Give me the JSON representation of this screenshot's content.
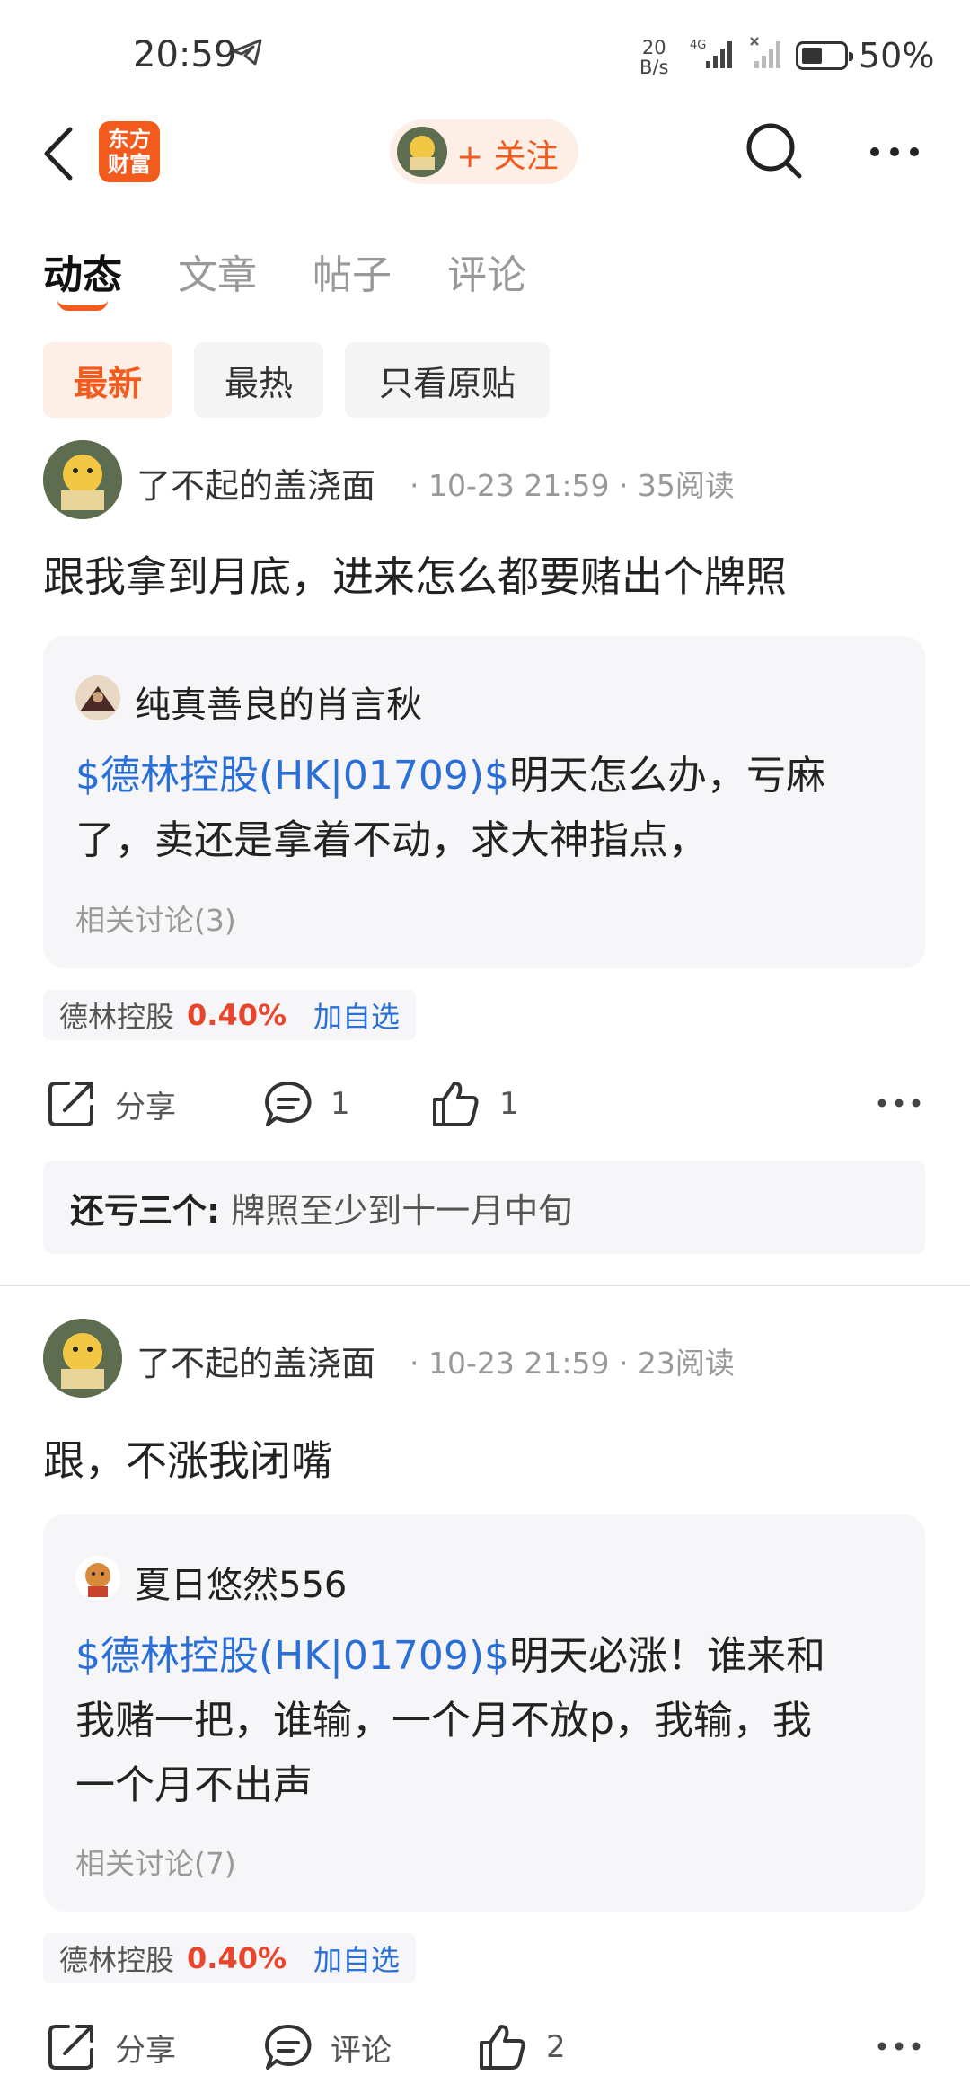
{
  "status_bar": {
    "time": "20:59",
    "speed_value": "20",
    "speed_unit": "B/s",
    "network": "4G",
    "battery": "50%"
  },
  "nav": {
    "logo_line1": "东方",
    "logo_line2": "财富",
    "follow_label": "+ 关注"
  },
  "tabs": [
    "动态",
    "文章",
    "帖子",
    "评论"
  ],
  "filters": [
    "最新",
    "最热",
    "只看原贴"
  ],
  "posts": [
    {
      "username": "了不起的盖浇面",
      "meta": "· 10-23 21:59 · 35阅读",
      "content": "跟我拿到月底，进来怎么都要赌出个牌照",
      "quote": {
        "author": "纯真善良的肖言秋",
        "stock_link": "$德林控股(HK|01709)$",
        "text_line1": "明天怎么办，亏麻",
        "text_line2": "了，卖还是拿着不动，求大神指点，",
        "related": "相关讨论(3)"
      },
      "tag": {
        "name": "德林控股",
        "percent": "0.40%",
        "add": "加自选"
      },
      "actions": {
        "share": "分享",
        "comment": "1",
        "like": "1"
      },
      "reply": {
        "author": "还亏三个:",
        "text": "牌照至少到十一月中旬"
      }
    },
    {
      "username": "了不起的盖浇面",
      "meta": "· 10-23 21:59 · 23阅读",
      "content": "跟，不涨我闭嘴",
      "quote": {
        "author": "夏日悠然556",
        "stock_link": "$德林控股(HK|01709)$",
        "text_line1": "明天必涨！谁来和",
        "text_line2": "我赌一把，谁输，一个月不放p，我输，我",
        "text_line3": "一个月不出声",
        "related": "相关讨论(7)"
      },
      "tag": {
        "name": "德林控股",
        "percent": "0.40%",
        "add": "加自选"
      },
      "actions": {
        "share": "分享",
        "comment": "评论",
        "like": "2"
      }
    }
  ],
  "colors": {
    "accent": "#f25a1e",
    "link": "#2a6fd8",
    "up": "#e8452c"
  }
}
